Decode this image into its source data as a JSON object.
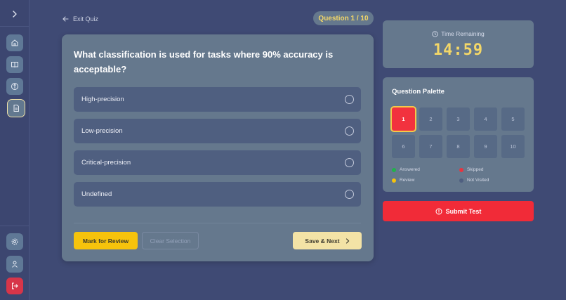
{
  "sidebar": {
    "toggle_icon": "chevron-right-icon",
    "top_items": [
      {
        "icon": "home-icon"
      },
      {
        "icon": "book-icon"
      },
      {
        "icon": "compass-icon"
      },
      {
        "icon": "document-icon",
        "active": true
      }
    ],
    "bottom_items": [
      {
        "icon": "gear-icon"
      },
      {
        "icon": "user-icon"
      },
      {
        "icon": "logout-icon"
      }
    ]
  },
  "header": {
    "exit_label": "Exit Quiz",
    "question_counter": "Question 1 / 10"
  },
  "question": {
    "text": "What classification is used for tasks where 90% accuracy is acceptable?",
    "options": [
      "High-precision",
      "Low-precision",
      "Critical-precision",
      "Undefined"
    ]
  },
  "actions": {
    "mark_review": "Mark for Review",
    "clear_selection": "Clear Selection",
    "save_next": "Save & Next"
  },
  "timer": {
    "label": "Time Remaining",
    "value": "14:59"
  },
  "palette": {
    "title": "Question Palette",
    "numbers": [
      "1",
      "2",
      "3",
      "4",
      "5",
      "6",
      "7",
      "8",
      "9",
      "10"
    ],
    "current": "1",
    "legend": {
      "answered": "Answered",
      "skipped": "Skipped",
      "review": "Review",
      "not_visited": "Not Visited"
    }
  },
  "submit_label": "Submit Test",
  "colors": {
    "background": "#3f4a74",
    "card": "#65788d",
    "accent_yellow": "#f3d768",
    "danger": "#f12b38",
    "answered": "#22b14c",
    "skipped": "#e8343f",
    "review": "#f6c30c",
    "not_visited": "#4f5f80"
  }
}
